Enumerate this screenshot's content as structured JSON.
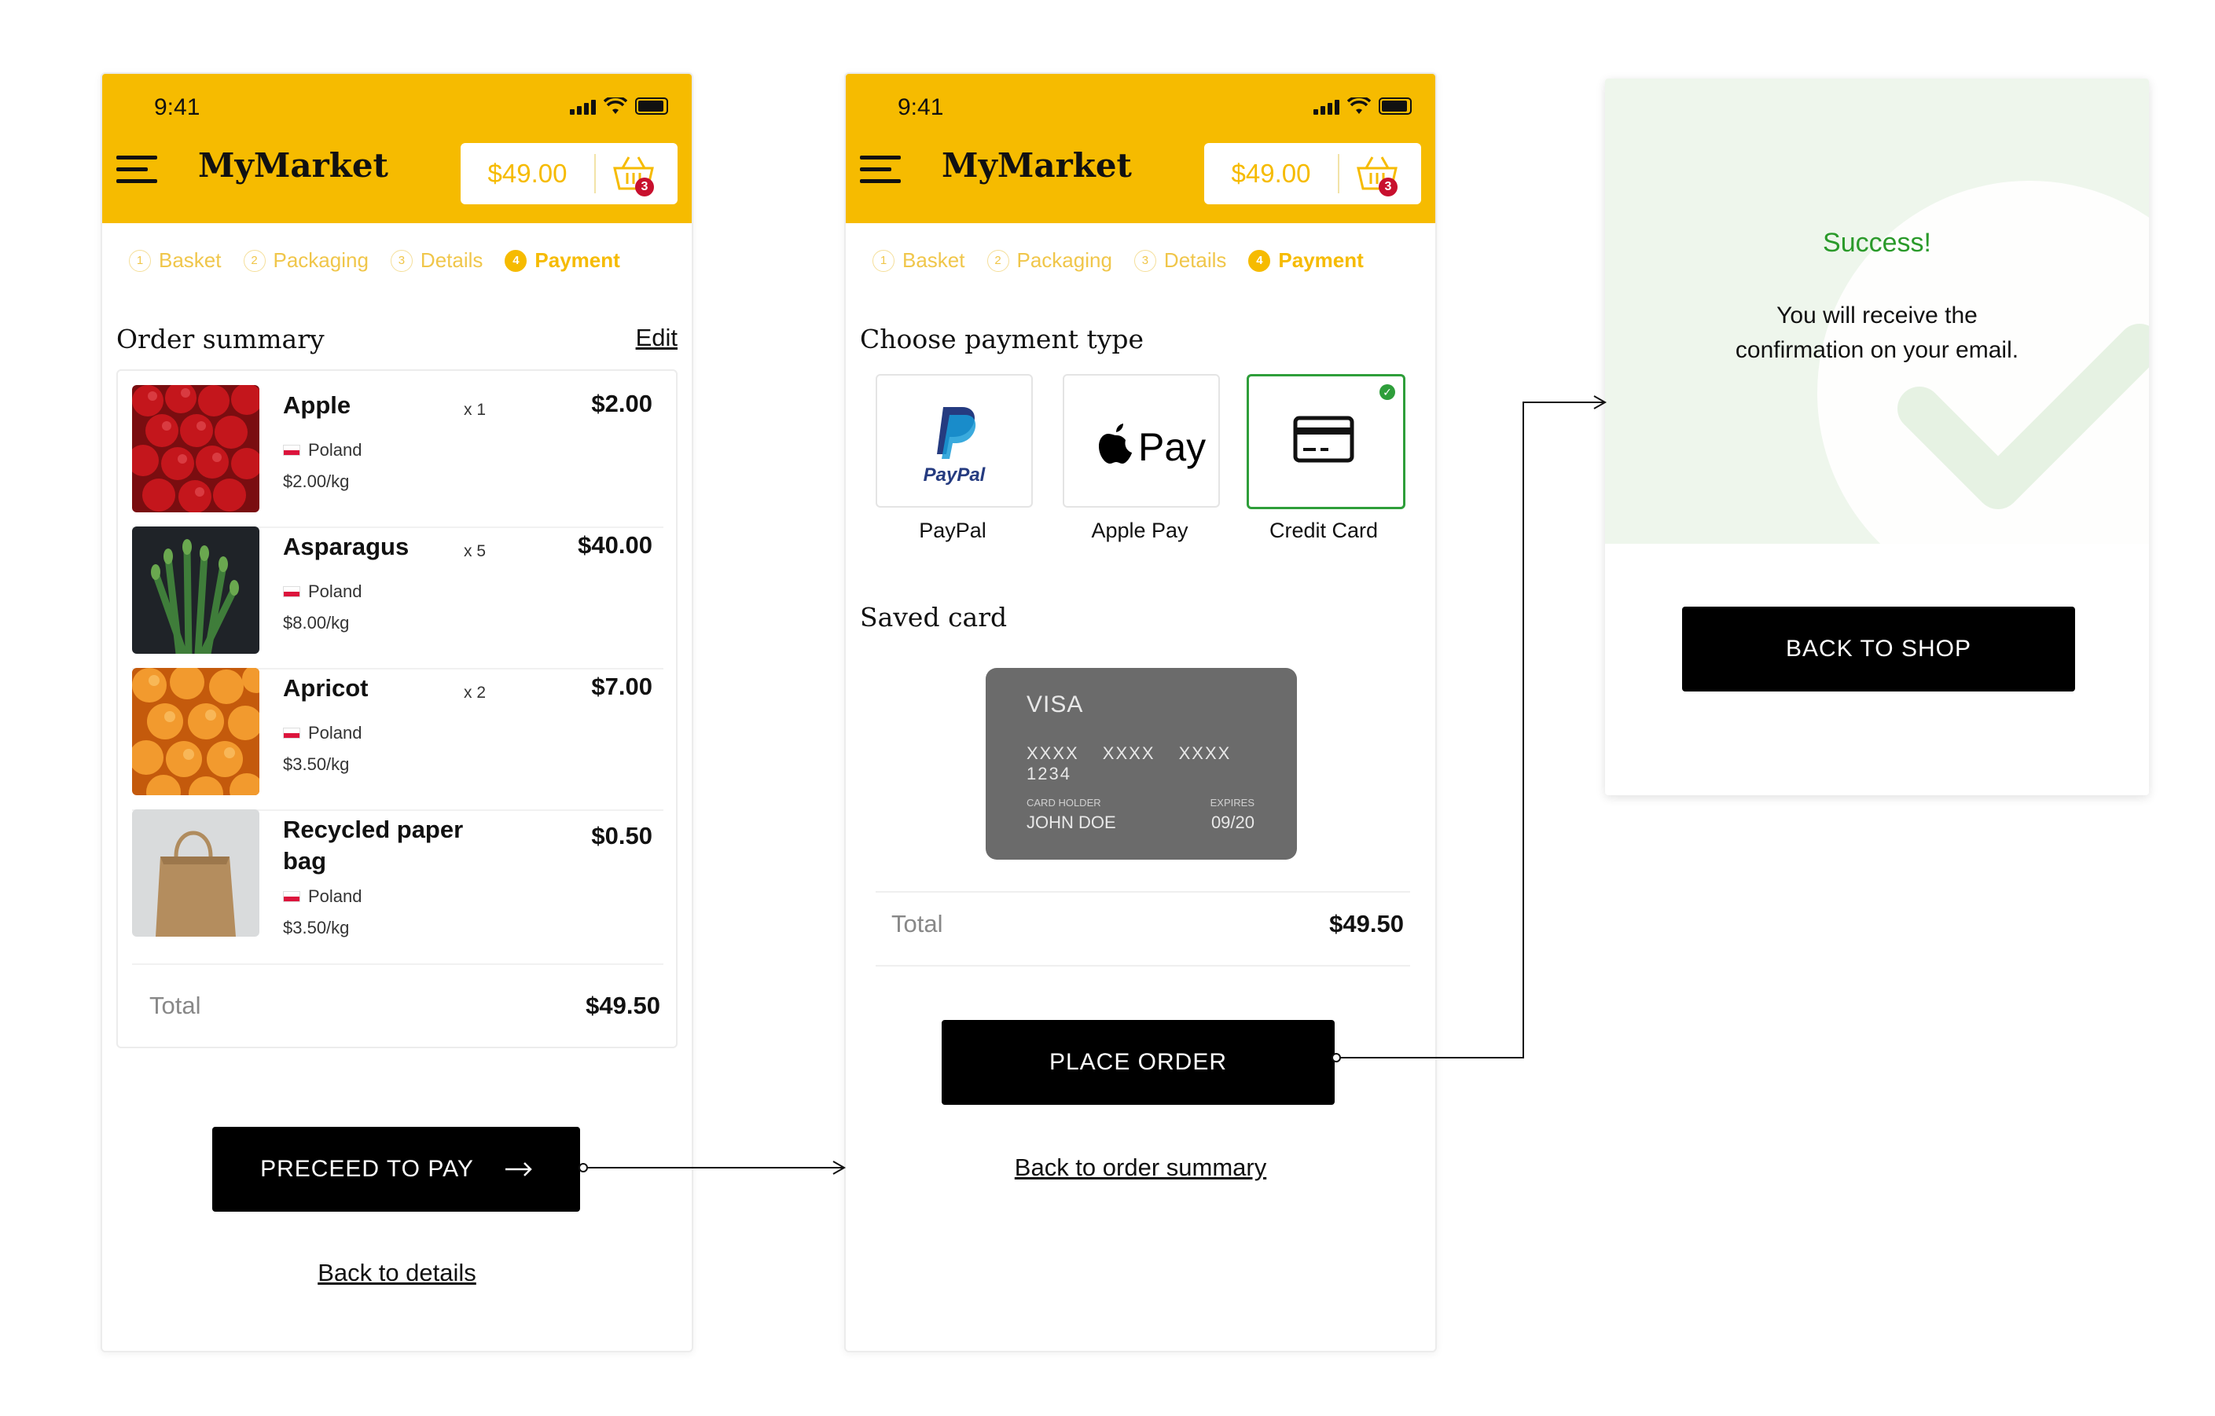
{
  "status": {
    "time": "9:41"
  },
  "app": {
    "brand": "MyMarket",
    "cart_total": "$49.00",
    "cart_count": "3"
  },
  "steps": [
    {
      "num": "1",
      "label": "Basket"
    },
    {
      "num": "2",
      "label": "Packaging"
    },
    {
      "num": "3",
      "label": "Details"
    },
    {
      "num": "4",
      "label": "Payment"
    }
  ],
  "summary": {
    "title": "Order summary",
    "edit_label": "Edit",
    "items": [
      {
        "name": "Apple",
        "qty": "x 1",
        "price": "$2.00",
        "origin": "Poland",
        "unit": "$2.00/kg"
      },
      {
        "name": "Asparagus",
        "qty": "x 5",
        "price": "$40.00",
        "origin": "Poland",
        "unit": "$8.00/kg"
      },
      {
        "name": "Apricot",
        "qty": "x 2",
        "price": "$7.00",
        "origin": "Poland",
        "unit": "$3.50/kg"
      },
      {
        "name": "Recycled paper bag",
        "qty": "",
        "price": "$0.50",
        "origin": "Poland",
        "unit": "$3.50/kg"
      }
    ],
    "total_label": "Total",
    "total_value": "$49.50",
    "proceed_label": "PRECEED TO PAY",
    "back_label": "Back to details"
  },
  "payment": {
    "title": "Choose payment type",
    "options": [
      {
        "label": "PayPal",
        "icon": "paypal-icon"
      },
      {
        "label": "Apple Pay",
        "icon": "apple-pay-icon"
      },
      {
        "label": "Credit Card",
        "icon": "credit-card-icon",
        "selected": true
      }
    ],
    "paypal_logo_text": "PayPal",
    "applepay_logo_text": "Pay",
    "saved_title": "Saved card",
    "card": {
      "brand": "VISA",
      "number": "XXXX XXXX XXXX 1234",
      "holder_label": "CARD HOLDER",
      "holder": "JOHN DOE",
      "expires_label": "EXPIRES",
      "expires": "09/20"
    },
    "total_label": "Total",
    "total_value": "$49.50",
    "place_order_label": "PLACE ORDER",
    "back_label": "Back to order summary"
  },
  "success": {
    "title": "Success!",
    "message_line1": "You will receive the",
    "message_line2": "confirmation on your email.",
    "back_label": "BACK TO SHOP"
  },
  "colors": {
    "accent": "#f6bb00",
    "success": "#2a9a2a",
    "button": "#000000"
  }
}
